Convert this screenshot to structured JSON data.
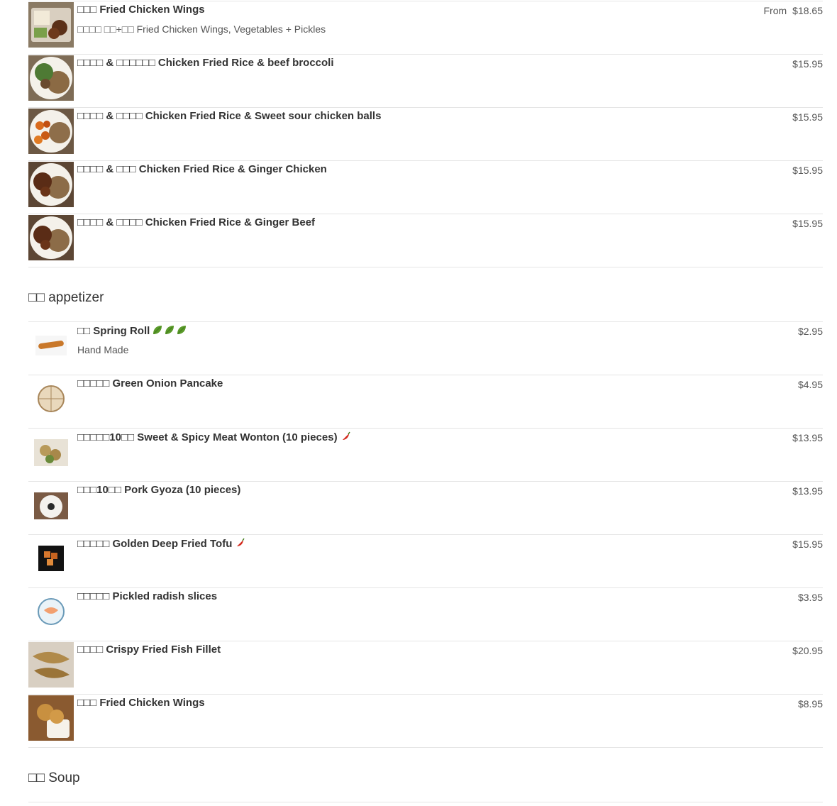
{
  "sections": [
    {
      "id": "top",
      "title": "",
      "items": [
        {
          "name": "□□□ Fried Chicken Wings",
          "desc": "□□□□ □□+□□ Fried Chicken Wings, Vegetables + Pickles",
          "from": "From",
          "price": "$18.65",
          "img": "box"
        },
        {
          "name": "□□□□ & □□□□□□ Chicken Fried Rice & beef broccoli",
          "price": "$15.95",
          "img": "plate-green"
        },
        {
          "name": "□□□□ & □□□□ Chicken Fried Rice & Sweet sour chicken balls",
          "price": "$15.95",
          "img": "plate-balls"
        },
        {
          "name": "□□□□ & □□□ Chicken Fried Rice & Ginger Chicken",
          "price": "$15.95",
          "img": "plate-brown"
        },
        {
          "name": "□□□□ & □□□□ Chicken Fried Rice & Ginger Beef",
          "price": "$15.95",
          "img": "plate-brown"
        }
      ]
    },
    {
      "id": "appetizer",
      "title": "□□ appetizer",
      "items": [
        {
          "name": "□□ Spring Roll",
          "desc": "Hand Made",
          "price": "$2.95",
          "img": "roll",
          "tags": [
            "vegetarian-leaf-icon",
            "vegetarian-leaf-icon",
            "vegetarian-leaf-icon"
          ]
        },
        {
          "name": "□□□□□ Green Onion Pancake",
          "price": "$4.95",
          "img": "pancake"
        },
        {
          "name": "□□□□□10□□ Sweet & Spicy Meat Wonton (10 pieces)",
          "price": "$13.95",
          "img": "wonton",
          "tags": [
            "spicy-pepper-icon"
          ]
        },
        {
          "name": "□□□10□□ Pork Gyoza (10 pieces)",
          "price": "$13.95",
          "img": "gyoza"
        },
        {
          "name": "□□□□□ Golden Deep Fried Tofu",
          "price": "$15.95",
          "img": "tofu",
          "tags": [
            "spicy-pepper-icon"
          ]
        },
        {
          "name": "□□□□□ Pickled radish slices",
          "price": "$3.95",
          "img": "radish"
        },
        {
          "name": "□□□□ Crispy Fried Fish Fillet",
          "price": "$20.95",
          "img": "fish"
        },
        {
          "name": "□□□ Fried Chicken Wings",
          "price": "$8.95",
          "img": "wings"
        }
      ]
    },
    {
      "id": "soup",
      "title": "□□ Soup",
      "items": []
    }
  ],
  "colors": {
    "text": "#333333",
    "muted": "#555555",
    "divider": "#e5e5e5",
    "leaf": "#5a9a2a",
    "pepper": "#d42a1e"
  }
}
